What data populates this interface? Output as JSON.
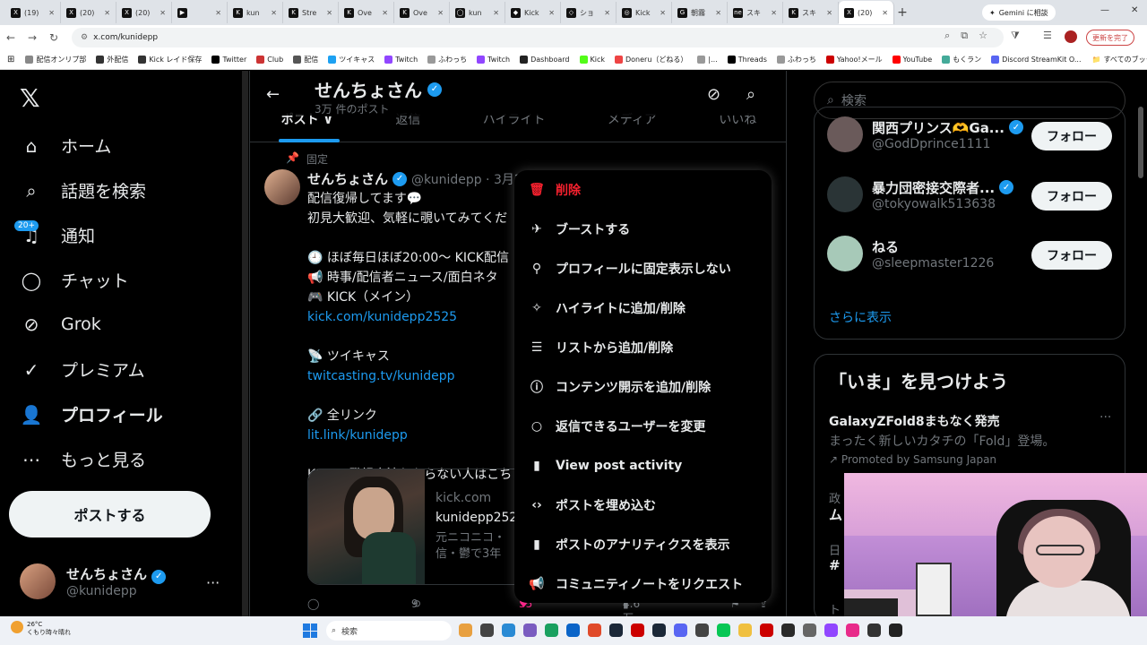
{
  "browser": {
    "tabs": [
      {
        "label": "(19)",
        "fav": "X"
      },
      {
        "label": "(20)",
        "fav": "X"
      },
      {
        "label": "(20)",
        "fav": "X"
      },
      {
        "label": "",
        "fav": "▶"
      },
      {
        "label": "kun",
        "fav": "K"
      },
      {
        "label": "Stre",
        "fav": "K"
      },
      {
        "label": "Ove",
        "fav": "K"
      },
      {
        "label": "Ove",
        "fav": "K"
      },
      {
        "label": "kun",
        "fav": "◯"
      },
      {
        "label": "Kick",
        "fav": "◆"
      },
      {
        "label": "ショ",
        "fav": "◇"
      },
      {
        "label": "Kick",
        "fav": "◎"
      },
      {
        "label": "朝霧",
        "fav": "G"
      },
      {
        "label": "スキ",
        "fav": "ne"
      },
      {
        "label": "スキ",
        "fav": "K"
      },
      {
        "label": "(20)",
        "fav": "X"
      }
    ],
    "gemini_label": "Gemini に相談",
    "url": "x.com/kunidepp",
    "update_label": "更新を完了",
    "bookmarks": [
      {
        "label": "配信オンリプ部",
        "color": "#888"
      },
      {
        "label": "外配信",
        "color": "#333"
      },
      {
        "label": "Kick レイド保存",
        "color": "#333"
      },
      {
        "label": "Twitter",
        "color": "#000"
      },
      {
        "label": "Club",
        "color": "#c33"
      },
      {
        "label": "配信",
        "color": "#555"
      },
      {
        "label": "ツイキャス",
        "color": "#1da1f2"
      },
      {
        "label": "Twitch",
        "color": "#9146ff"
      },
      {
        "label": "ふわっち",
        "color": "#999"
      },
      {
        "label": "Twitch",
        "color": "#9146ff"
      },
      {
        "label": "Dashboard",
        "color": "#222"
      },
      {
        "label": "Kick",
        "color": "#53fc18"
      },
      {
        "label": "Doneru（どねる）",
        "color": "#e44"
      },
      {
        "label": "|...",
        "color": "#999"
      },
      {
        "label": "Threads",
        "color": "#000"
      },
      {
        "label": "ふわっち",
        "color": "#999"
      },
      {
        "label": "Yahoo!メール",
        "color": "#c00"
      },
      {
        "label": "YouTube",
        "color": "#f00"
      },
      {
        "label": "もくラン",
        "color": "#4a9"
      },
      {
        "label": "Discord StreamKit O...",
        "color": "#5865f2"
      }
    ],
    "all_bookmarks": "すべてのブックマーク"
  },
  "nav": {
    "items": [
      {
        "label": "ホーム",
        "icon": "home-icon",
        "glyph": "⌂"
      },
      {
        "label": "話題を検索",
        "icon": "search-icon",
        "glyph": "⌕"
      },
      {
        "label": "通知",
        "icon": "bell-icon",
        "glyph": "♫"
      },
      {
        "label": "チャット",
        "icon": "chat-icon",
        "glyph": "◯"
      },
      {
        "label": "Grok",
        "icon": "grok-icon",
        "glyph": "⊘"
      },
      {
        "label": "プレミアム",
        "icon": "premium-icon",
        "glyph": "✓"
      },
      {
        "label": "プロフィール",
        "icon": "profile-icon",
        "glyph": "👤"
      },
      {
        "label": "もっと見る",
        "icon": "more-icon",
        "glyph": "⋯"
      }
    ],
    "notif_badge": "20+",
    "post_button": "ポストする",
    "me_name": "せんちょさん",
    "me_handle": "@kunidepp"
  },
  "profile": {
    "name": "せんちょさん",
    "post_count": "3万 件のポスト",
    "tabs": [
      "ポスト ∨",
      "返信",
      "ハイライト",
      "メディア",
      "いいね"
    ]
  },
  "post": {
    "pinned_label": "固定",
    "name": "せんちょさん",
    "handle": "@kunidepp · 3月2",
    "lines": [
      "配信復帰してます💬",
      "初見大歓迎、気軽に覗いてみてくだ",
      "",
      "🕘 ほぼ毎日ほぼ20:00〜 KICK配信",
      "📢 時事/配信者ニュース/面白ネタ",
      "🎮 KICK（メイン）",
      " kick.com/kunidepp2525",
      "",
      "📡 ツイキャス",
      "twitcasting.tv/kunidepp",
      "",
      "🔗 全リンク",
      "lit.link/kunidepp",
      "",
      "KICKの登録方法わからない人はこち"
    ],
    "card_domain": "kick.com",
    "card_title": "kunidepp252",
    "card_desc1": "元ニコニコ・",
    "card_desc2": "信・鬱で3年",
    "replies": "",
    "reposts": "9",
    "likes": "35",
    "views": "4.6万"
  },
  "menu": {
    "items": [
      {
        "label": "削除",
        "glyph": "🗑",
        "name": "delete",
        "danger": true
      },
      {
        "label": "ブーストする",
        "glyph": "✈",
        "name": "boost"
      },
      {
        "label": "プロフィールに固定表示しない",
        "glyph": "⚲",
        "name": "unpin"
      },
      {
        "label": "ハイライトに追加/削除",
        "glyph": "✧",
        "name": "highlight"
      },
      {
        "label": "リストから追加/削除",
        "glyph": "☰",
        "name": "list"
      },
      {
        "label": "コンテンツ開示を追加/削除",
        "glyph": "ⓘ",
        "name": "disclosure"
      },
      {
        "label": "返信できるユーザーを変更",
        "glyph": "○",
        "name": "reply-settings"
      },
      {
        "label": "View post activity",
        "glyph": "▮",
        "name": "post-activity"
      },
      {
        "label": "ポストを埋め込む",
        "glyph": "‹›",
        "name": "embed"
      },
      {
        "label": "ポストのアナリティクスを表示",
        "glyph": "▮",
        "name": "analytics"
      },
      {
        "label": "コミュニティノートをリクエスト",
        "glyph": "📢",
        "name": "community-note"
      }
    ]
  },
  "sidebar": {
    "search_placeholder": "検索",
    "follow": [
      {
        "name": "関西プリンス🫶Ga...",
        "handle": "@GodDprince1111",
        "verified": true,
        "color": "#6a5a5a"
      },
      {
        "name": "暴力団密接交際者...",
        "handle": "@tokyowalk513638",
        "verified": true,
        "color": "#2a3436"
      },
      {
        "name": "ねる",
        "handle": "@sleepmaster1226",
        "verified": false,
        "color": "#a7c9b8"
      }
    ],
    "follow_button": "フォロー",
    "show_more": "さらに表示",
    "trends_title": "「いま」を見つけよう",
    "trend_title": "GalaxyZFold8まもなく発売",
    "trend_desc": "まったく新しいカタチの「Fold」登場。",
    "trend_promo": "Promoted by Samsung Japan",
    "trend2_a": "政",
    "trend2_b": "ム",
    "trend3_a": "日",
    "trend3_b": "#",
    "trend4": "ト"
  },
  "taskbar": {
    "temp": "26°C",
    "weather": "くもり時々晴れ",
    "search": "検索"
  }
}
